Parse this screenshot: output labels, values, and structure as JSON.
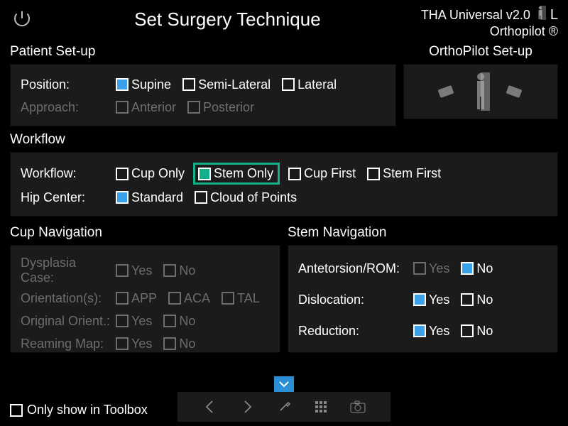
{
  "header": {
    "title": "Set Surgery Technique",
    "version": "THA Universal v2.0",
    "side": "L",
    "brand": "Orthopilot ®"
  },
  "patient_setup": {
    "section": "Patient Set-up",
    "position_label": "Position:",
    "approach_label": "Approach:",
    "position": {
      "supine": "Supine",
      "semi_lateral": "Semi-Lateral",
      "lateral": "Lateral"
    },
    "approach": {
      "anterior": "Anterior",
      "posterior": "Posterior"
    }
  },
  "op_setup": {
    "section": "OrthoPilot Set-up"
  },
  "workflow": {
    "section": "Workflow",
    "workflow_label": "Workflow:",
    "hip_center_label": "Hip Center:",
    "opts": {
      "cup_only": "Cup Only",
      "stem_only": "Stem Only",
      "cup_first": "Cup First",
      "stem_first": "Stem First"
    },
    "hip": {
      "standard": "Standard",
      "cloud": "Cloud of Points"
    }
  },
  "cup_nav": {
    "section": "Cup Navigation",
    "dysplasia": "Dysplasia Case:",
    "orientations": "Orientation(s):",
    "original_orient": "Original Orient.:",
    "reaming": "Reaming Map:",
    "orient_opts": {
      "app": "APP",
      "aca": "ACA",
      "tal": "TAL"
    }
  },
  "stem_nav": {
    "section": "Stem Navigation",
    "antetorsion": "Antetorsion/ROM:",
    "dislocation": "Dislocation:",
    "reduction": "Reduction:"
  },
  "common": {
    "yes": "Yes",
    "no": "No"
  },
  "footer": {
    "toolbox": "Only show in Toolbox"
  }
}
